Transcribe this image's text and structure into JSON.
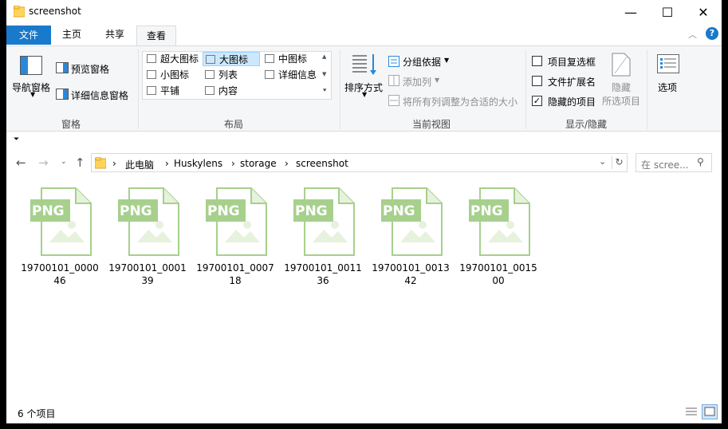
{
  "window": {
    "title": "screenshot",
    "minimize": "—",
    "maximize": "☐",
    "close": "✕"
  },
  "tabs": [
    "文件",
    "主页",
    "共享",
    "查看"
  ],
  "ribbon": {
    "pane_group": {
      "nav_pane": "导航窗格",
      "preview_pane": "预览窗格",
      "details_pane": "详细信息窗格",
      "label": "窗格"
    },
    "layout_group": {
      "items": [
        "超大图标",
        "大图标",
        "中图标",
        "小图标",
        "列表",
        "详细信息",
        "平铺",
        "内容"
      ],
      "selected": "大图标",
      "label": "布局"
    },
    "view_group": {
      "sort_by": "排序方式",
      "group_by": "分组依据",
      "add_column": "添加列",
      "fit_columns": "将所有列调整为合适的大小",
      "label": "当前视图"
    },
    "show_hide_group": {
      "item_checkboxes": "项目复选框",
      "file_extensions": "文件扩展名",
      "hidden_items": "隐藏的项目",
      "hide_selected_line1": "隐藏",
      "hide_selected_line2": "所选项目",
      "label": "显示/隐藏",
      "checked": {
        "item_checkboxes": false,
        "file_extensions": false,
        "hidden_items": true
      }
    },
    "options": "选项"
  },
  "address": {
    "crumbs": [
      "此电脑",
      "Huskylens",
      "storage",
      "screenshot"
    ],
    "search_placeholder": "在 scree..."
  },
  "files": [
    {
      "line1": "19700101_0000",
      "line2": "46",
      "badge": "PNG"
    },
    {
      "line1": "19700101_0001",
      "line2": "39",
      "badge": "PNG"
    },
    {
      "line1": "19700101_0007",
      "line2": "18",
      "badge": "PNG"
    },
    {
      "line1": "19700101_0011",
      "line2": "36",
      "badge": "PNG"
    },
    {
      "line1": "19700101_0013",
      "line2": "42",
      "badge": "PNG"
    },
    {
      "line1": "19700101_0015",
      "line2": "00",
      "badge": "PNG"
    }
  ],
  "status": {
    "count": "6 个项目"
  },
  "colors": {
    "accent": "#1979ca",
    "png_icon": "#a6d08c",
    "ribbon_bg": "#f5f6f7"
  }
}
